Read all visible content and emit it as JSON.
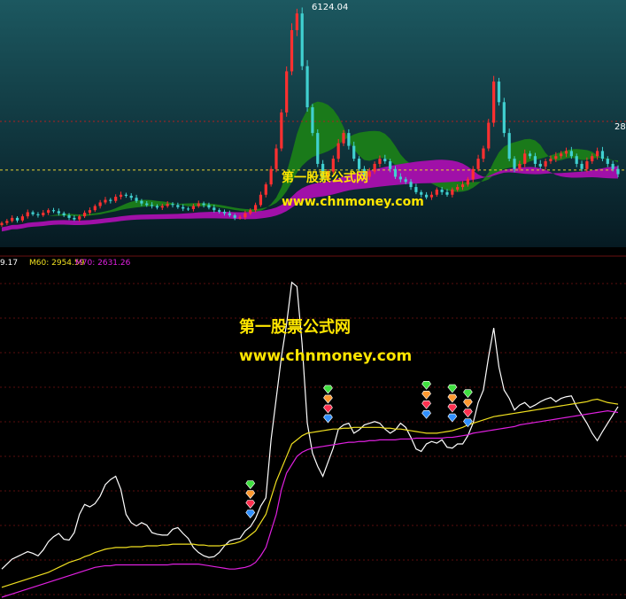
{
  "chart_data": [
    {
      "type": "candlestick",
      "panel": "price",
      "title": "",
      "price_labels": {
        "peak": "6124.04",
        "right_edge": "28"
      },
      "reference_level": 3080,
      "ylim": [
        1700,
        6300
      ],
      "x_count": 120,
      "close": [
        2050,
        2090,
        2150,
        2100,
        2180,
        2260,
        2220,
        2200,
        2250,
        2300,
        2280,
        2240,
        2200,
        2150,
        2120,
        2180,
        2250,
        2300,
        2380,
        2450,
        2500,
        2480,
        2560,
        2600,
        2580,
        2540,
        2480,
        2430,
        2400,
        2380,
        2350,
        2380,
        2420,
        2400,
        2360,
        2330,
        2320,
        2380,
        2430,
        2400,
        2350,
        2300,
        2270,
        2240,
        2200,
        2150,
        2160,
        2240,
        2300,
        2400,
        2600,
        2800,
        3100,
        3500,
        4200,
        5000,
        5800,
        6124,
        5100,
        4300,
        3800,
        3200,
        2900,
        3050,
        3300,
        3600,
        3800,
        3550,
        3300,
        3100,
        2950,
        3050,
        3200,
        3300,
        3250,
        3100,
        2950,
        2900,
        2850,
        2750,
        2650,
        2600,
        2550,
        2600,
        2700,
        2650,
        2600,
        2700,
        2750,
        2800,
        2900,
        3100,
        3300,
        3500,
        4000,
        4800,
        4400,
        3800,
        3300,
        3100,
        3200,
        3400,
        3350,
        3200,
        3150,
        3250,
        3300,
        3350,
        3400,
        3450,
        3350,
        3200,
        3100,
        3250,
        3350,
        3450,
        3300,
        3200,
        3100,
        3000
      ]
    },
    {
      "type": "line",
      "panel": "indicator",
      "title": "",
      "legend": [
        "9.17",
        "M60: 2954.59",
        "M70: 2631.26"
      ],
      "ylim": [
        2300,
        6300
      ],
      "x_count": 120,
      "series": [
        {
          "color": "#ffffff",
          "values": [
            2640,
            2700,
            2760,
            2790,
            2820,
            2850,
            2830,
            2800,
            2870,
            2970,
            3030,
            3070,
            3000,
            2990,
            3080,
            3300,
            3420,
            3390,
            3430,
            3520,
            3660,
            3720,
            3760,
            3600,
            3300,
            3200,
            3160,
            3200,
            3170,
            3080,
            3060,
            3050,
            3050,
            3120,
            3140,
            3070,
            3010,
            2900,
            2840,
            2800,
            2780,
            2790,
            2840,
            2920,
            2980,
            3000,
            3010,
            3100,
            3150,
            3250,
            3400,
            3500,
            4200,
            4700,
            5200,
            5600,
            6100,
            6050,
            5350,
            4400,
            4040,
            3880,
            3760,
            3930,
            4100,
            4330,
            4380,
            4400,
            4280,
            4320,
            4380,
            4400,
            4420,
            4400,
            4330,
            4280,
            4320,
            4400,
            4350,
            4230,
            4090,
            4060,
            4150,
            4180,
            4160,
            4200,
            4110,
            4100,
            4150,
            4150,
            4250,
            4400,
            4650,
            4800,
            5200,
            5550,
            5080,
            4800,
            4700,
            4560,
            4620,
            4650,
            4590,
            4620,
            4660,
            4690,
            4710,
            4660,
            4700,
            4720,
            4730,
            4600,
            4500,
            4400,
            4280,
            4190,
            4300,
            4400,
            4500,
            4600
          ]
        },
        {
          "name": "M60",
          "color": "#f0e020",
          "values": [
            2420,
            2440,
            2460,
            2480,
            2500,
            2520,
            2540,
            2560,
            2580,
            2600,
            2630,
            2660,
            2690,
            2720,
            2740,
            2760,
            2790,
            2810,
            2840,
            2860,
            2880,
            2890,
            2900,
            2900,
            2900,
            2910,
            2910,
            2910,
            2920,
            2920,
            2920,
            2930,
            2930,
            2940,
            2940,
            2940,
            2940,
            2940,
            2930,
            2930,
            2920,
            2920,
            2920,
            2930,
            2940,
            2950,
            2970,
            3000,
            3050,
            3100,
            3200,
            3300,
            3500,
            3700,
            3850,
            4000,
            4150,
            4200,
            4250,
            4280,
            4290,
            4300,
            4310,
            4320,
            4330,
            4330,
            4340,
            4340,
            4350,
            4350,
            4350,
            4350,
            4350,
            4350,
            4340,
            4340,
            4330,
            4330,
            4320,
            4310,
            4300,
            4290,
            4280,
            4280,
            4280,
            4290,
            4300,
            4310,
            4330,
            4350,
            4380,
            4400,
            4420,
            4440,
            4460,
            4480,
            4490,
            4500,
            4510,
            4520,
            4530,
            4540,
            4550,
            4560,
            4570,
            4580,
            4590,
            4600,
            4610,
            4620,
            4630,
            4640,
            4650,
            4660,
            4680,
            4690,
            4670,
            4650,
            4640,
            4630
          ]
        },
        {
          "name": "M70",
          "color": "#e020e0",
          "values": [
            2300,
            2320,
            2340,
            2360,
            2380,
            2400,
            2420,
            2440,
            2460,
            2480,
            2500,
            2520,
            2540,
            2560,
            2580,
            2600,
            2620,
            2640,
            2660,
            2670,
            2680,
            2680,
            2690,
            2690,
            2690,
            2690,
            2690,
            2690,
            2690,
            2690,
            2690,
            2690,
            2690,
            2700,
            2700,
            2700,
            2700,
            2700,
            2700,
            2690,
            2680,
            2670,
            2660,
            2650,
            2640,
            2640,
            2650,
            2660,
            2680,
            2720,
            2800,
            2900,
            3100,
            3300,
            3600,
            3800,
            3900,
            4000,
            4050,
            4080,
            4100,
            4110,
            4120,
            4130,
            4140,
            4150,
            4160,
            4170,
            4170,
            4180,
            4180,
            4190,
            4190,
            4200,
            4200,
            4200,
            4200,
            4210,
            4210,
            4210,
            4220,
            4220,
            4220,
            4220,
            4220,
            4220,
            4230,
            4230,
            4240,
            4250,
            4260,
            4280,
            4290,
            4300,
            4310,
            4320,
            4330,
            4340,
            4350,
            4360,
            4380,
            4390,
            4400,
            4410,
            4420,
            4430,
            4440,
            4450,
            4460,
            4470,
            4480,
            4490,
            4500,
            4510,
            4520,
            4530,
            4540,
            4550,
            4540,
            4530
          ]
        }
      ],
      "signals": [
        {
          "x": 48,
          "y": 3300
        },
        {
          "x": 63,
          "y": 4450
        },
        {
          "x": 82,
          "y": 4500
        },
        {
          "x": 87,
          "y": 4460
        },
        {
          "x": 90,
          "y": 4400
        }
      ]
    }
  ],
  "watermark": {
    "name": "第一股票公式网",
    "url": "www.chnmoney.com"
  }
}
